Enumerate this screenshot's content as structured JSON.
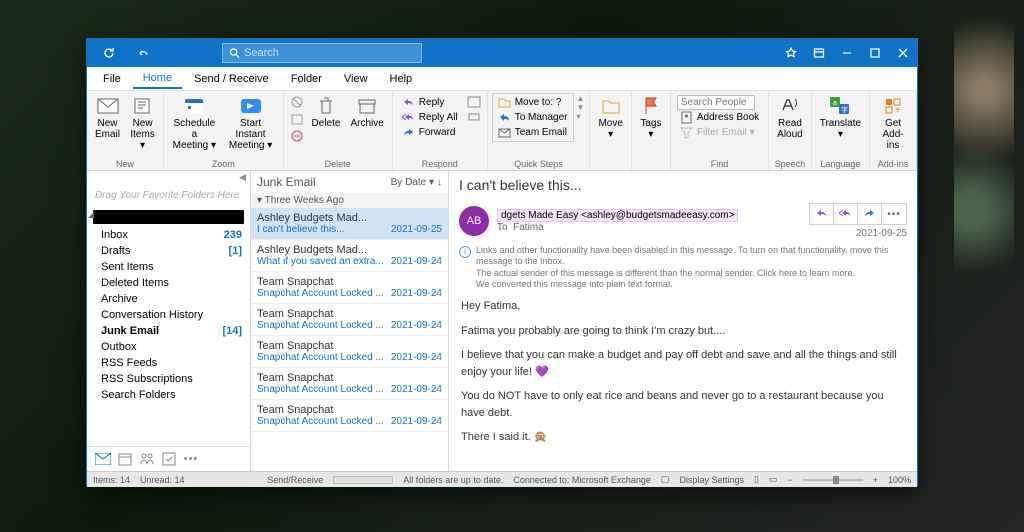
{
  "titlebar": {
    "search_placeholder": "Search"
  },
  "menu": {
    "file": "File",
    "home": "Home",
    "sendreceive": "Send / Receive",
    "folder": "Folder",
    "view": "View",
    "help": "Help"
  },
  "ribbon": {
    "new_email": "New\nEmail",
    "new_items": "New\nItems ▾",
    "g_new": "New",
    "schedule": "Schedule a\nMeeting ▾",
    "start_meeting": "Start Instant\nMeeting ▾",
    "g_zoom": "Zoom",
    "delete": "Delete",
    "archive": "Archive",
    "g_delete": "Delete",
    "reply": "Reply",
    "reply_all": "Reply All",
    "forward": "Forward",
    "g_respond": "Respond",
    "move_to": "Move to: ?",
    "to_manager": "To Manager",
    "team_email": "Team Email",
    "g_quicksteps": "Quick Steps",
    "move": "Move\n▾",
    "tags": "Tags\n▾",
    "search_people_ph": "Search People",
    "address_book": "Address Book",
    "filter_email": "Filter Email ▾",
    "g_find": "Find",
    "read_aloud": "Read\nAloud",
    "g_speech": "Speech",
    "translate": "Translate\n▾",
    "g_language": "Language",
    "get_addins": "Get\nAdd-ins",
    "g_addins": "Add-ins"
  },
  "folders": {
    "fav_hint": "Drag Your Favorite Folders Here",
    "items": [
      {
        "label": "Inbox",
        "count": "239"
      },
      {
        "label": "Drafts",
        "count": "[1]"
      },
      {
        "label": "Sent Items",
        "count": ""
      },
      {
        "label": "Deleted Items",
        "count": ""
      },
      {
        "label": "Archive",
        "count": ""
      },
      {
        "label": "Conversation History",
        "count": ""
      },
      {
        "label": "Junk Email",
        "count": "[14]"
      },
      {
        "label": "Outbox",
        "count": ""
      },
      {
        "label": "RSS Feeds",
        "count": ""
      },
      {
        "label": "RSS Subscriptions",
        "count": ""
      },
      {
        "label": "Search Folders",
        "count": ""
      }
    ],
    "selected_index": 6
  },
  "msglist": {
    "title": "Junk Email",
    "sort": "By Date ▾",
    "group": "Three Weeks Ago",
    "items": [
      {
        "from": "Ashley Budgets Mad...",
        "subj": "I can't believe this...",
        "dt": "2021-09-25"
      },
      {
        "from": "Ashley Budgets Mad...",
        "subj": "What if you saved an extra...",
        "dt": "2021-09-24"
      },
      {
        "from": "Team Snapchat",
        "subj": "Snapchat Account Locked ...",
        "dt": "2021-09-24"
      },
      {
        "from": "Team Snapchat",
        "subj": "Snapchat Account Locked ...",
        "dt": "2021-09-24"
      },
      {
        "from": "Team Snapchat",
        "subj": "Snapchat Account Locked ...",
        "dt": "2021-09-24"
      },
      {
        "from": "Team Snapchat",
        "subj": "Snapchat Account Locked ...",
        "dt": "2021-09-24"
      },
      {
        "from": "Team Snapchat",
        "subj": "Snapchat Account Locked ...",
        "dt": "2021-09-24"
      }
    ],
    "selected_index": 0
  },
  "reading": {
    "subject": "I can't believe this...",
    "avatar": "AB",
    "sender_display": "dgets Made Easy <ashley@budgetsmadeeasy.com>",
    "to_label": "To",
    "to_value": "Fatima",
    "date": "2021-09-25",
    "info1": "Links and other functionality have been disabled in this message. To turn on that functionality, move this message to the Inbox.",
    "info2": "The actual sender of this message is different than the normal sender. Click here to learn more.",
    "info3": "We converted this message into plain text format.",
    "body_p1": "Hey Fatima,",
    "body_p2": "Fatima you probably are going to think I'm crazy but....",
    "body_p3": "I believe that you can make a budget and pay off debt and save and all the things and still enjoy your life! 💜",
    "body_p4": "You do NOT have to only eat rice and beans and never go to a restaurant because you have debt.",
    "body_p5": "There I said it. 🙊"
  },
  "status": {
    "items": "Items: 14",
    "unread": "Unread: 14",
    "sr": "Send/Receive",
    "folders_ok": "All folders are up to date.",
    "connected": "Connected to: Microsoft Exchange",
    "display": "Display Settings",
    "zoom": "100%"
  }
}
